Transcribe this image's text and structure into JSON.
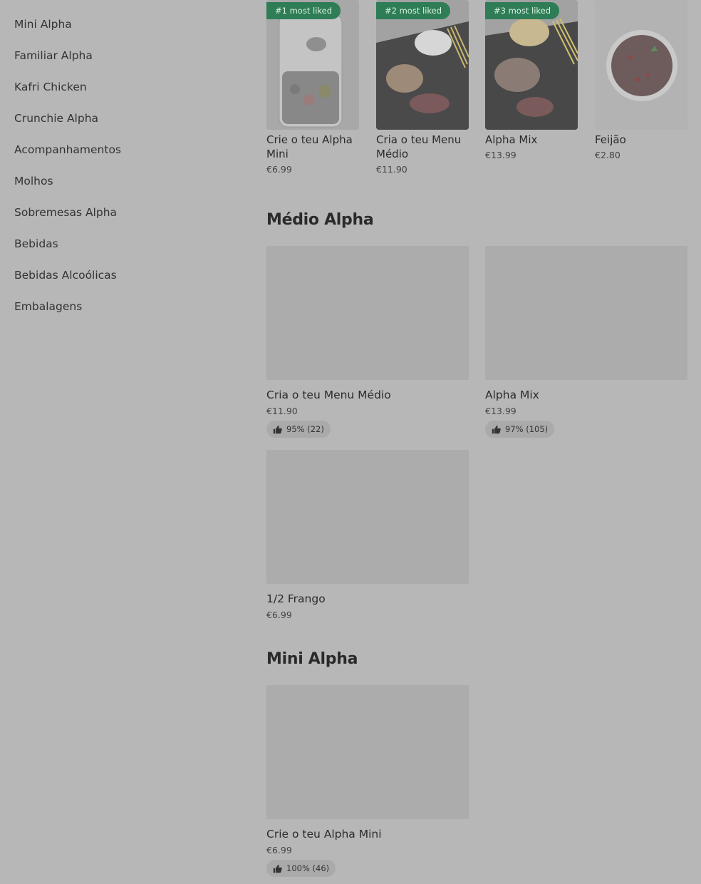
{
  "sidebar": {
    "items": [
      {
        "label": "Mini Alpha"
      },
      {
        "label": "Familiar Alpha"
      },
      {
        "label": "Kafri Chicken"
      },
      {
        "label": "Crunchie Alpha"
      },
      {
        "label": "Acompanhamentos"
      },
      {
        "label": "Molhos"
      },
      {
        "label": "Sobremesas Alpha"
      },
      {
        "label": "Bebidas"
      },
      {
        "label": "Bebidas Alcoólicas"
      },
      {
        "label": "Embalagens"
      }
    ]
  },
  "featured": [
    {
      "badge": "#1 most liked",
      "name": "Crie o teu  Alpha Mini",
      "price": "€6.99"
    },
    {
      "badge": "#2 most liked",
      "name": "Cria o teu Menu Médio",
      "price": "€11.90"
    },
    {
      "badge": "#3 most liked",
      "name": "Alpha Mix",
      "price": "€13.99"
    },
    {
      "badge": "",
      "name": "Feijão",
      "price": "€2.80"
    }
  ],
  "sections": [
    {
      "title": "Médio Alpha",
      "items": [
        {
          "name": "Cria o teu Menu Médio",
          "price": "€11.90",
          "rating": "95% (22)"
        },
        {
          "name": "Alpha Mix",
          "price": "€13.99",
          "rating": "97% (105)"
        },
        {
          "name": "1/2  Frango",
          "price": "€6.99",
          "rating": ""
        }
      ]
    },
    {
      "title": "Mini Alpha",
      "items": [
        {
          "name": "Crie o teu  Alpha Mini",
          "price": "€6.99",
          "rating": "100% (46)"
        }
      ]
    }
  ],
  "icons": {
    "rating": "thumbs-up-icon"
  },
  "colors": {
    "badge_bg": "#2f7d57",
    "page_bg": "#b7b7b7"
  }
}
